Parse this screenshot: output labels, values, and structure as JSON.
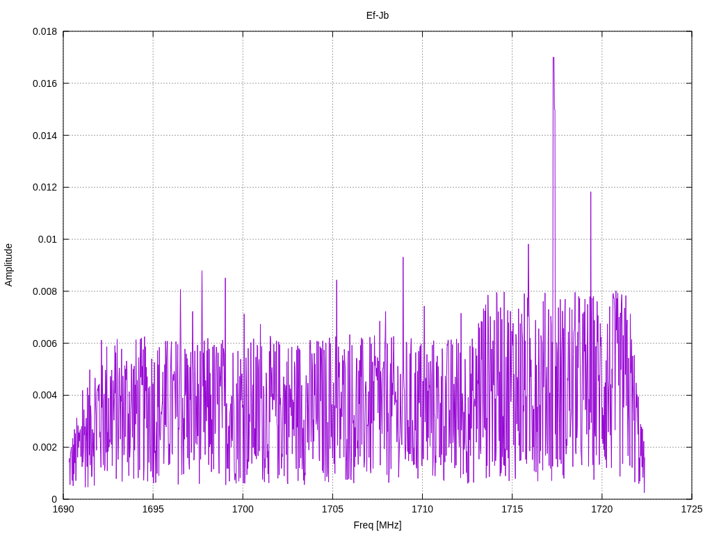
{
  "plot": {
    "title": "Ef-Jb",
    "xlabel": "Freq [MHz]",
    "ylabel": "Amplitude",
    "xticks": [
      "1690",
      "1695",
      "1700",
      "1705",
      "1710",
      "1715",
      "1720",
      "1725"
    ],
    "yticks": [
      "0.018",
      "0.016",
      "0.014",
      "0.012",
      "0.01",
      "0.008",
      "0.006",
      "0.004",
      "0.002",
      "0"
    ]
  }
}
